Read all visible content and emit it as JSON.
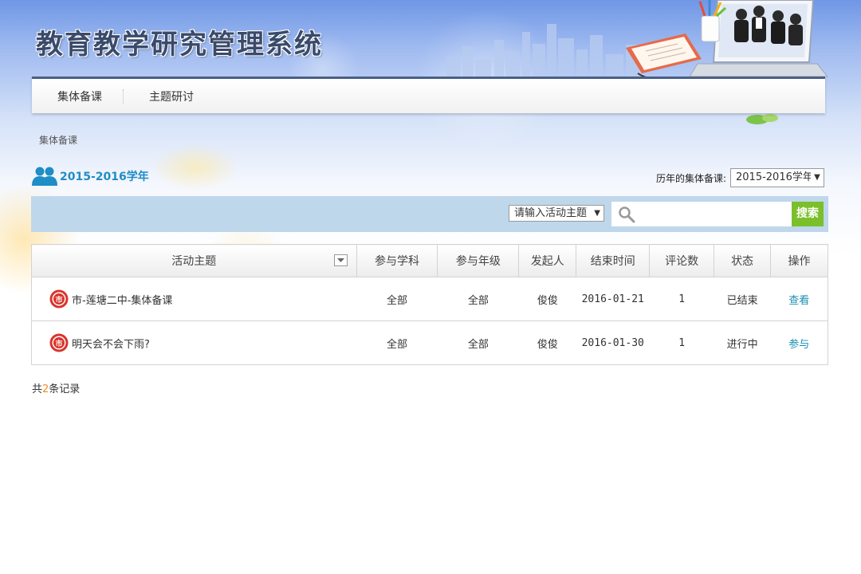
{
  "header": {
    "title": "教育教学研究管理系统"
  },
  "nav": {
    "items": [
      {
        "label": "集体备课"
      },
      {
        "label": "主题研讨"
      }
    ]
  },
  "breadcrumb": "集体备课",
  "year_section": {
    "title": "2015-2016学年",
    "history_label": "历年的集体备课:",
    "history_selected": "2015-2016学年"
  },
  "search": {
    "topic_select": "请输入活动主题",
    "input_value": "",
    "button_label": "搜索"
  },
  "table": {
    "headers": [
      "活动主题",
      "参与学科",
      "参与年级",
      "发起人",
      "结束时间",
      "评论数",
      "状态",
      "操作"
    ],
    "rows": [
      {
        "badge": "市",
        "topic": "市-莲塘二中-集体备课",
        "subject": "全部",
        "grade": "全部",
        "initiator": "俊俊",
        "end_time": "2016-01-21",
        "comments": "1",
        "status": "已结束",
        "action": "查看"
      },
      {
        "badge": "市",
        "topic": "明天会不会下雨?",
        "subject": "全部",
        "grade": "全部",
        "initiator": "俊俊",
        "end_time": "2016-01-30",
        "comments": "1",
        "status": "进行中",
        "action": "参与"
      }
    ]
  },
  "footer": {
    "total_prefix": "共",
    "total_count": "2",
    "total_suffix": "条记录"
  },
  "colors": {
    "nav_border": "#4a5f86",
    "year_title": "#1f8dc6",
    "search_bar": "#bfd7eb",
    "search_button": "#7bbf2a",
    "badge_red": "#d9342b",
    "link": "#1a8fb0",
    "count_highlight": "#f08a24"
  }
}
